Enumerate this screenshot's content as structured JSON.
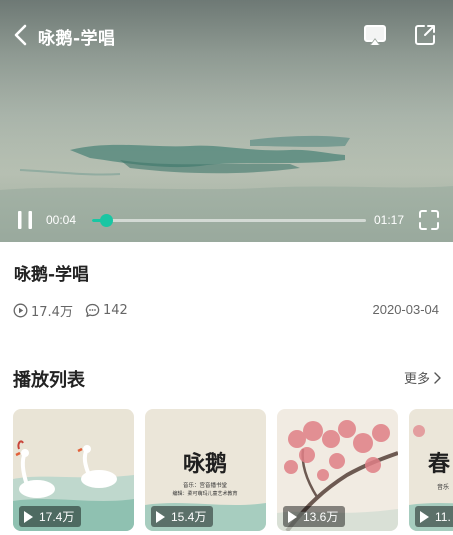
{
  "player": {
    "title": "咏鹅-学唱",
    "current_time": "00:04",
    "total_time": "01:17",
    "progress": 0.052,
    "accent": "#19c6a3",
    "icons": {
      "back": "chevron-left-icon",
      "cast": "cast-icon",
      "share": "share-icon",
      "pause": "pause-icon",
      "fullscreen": "fullscreen-icon"
    }
  },
  "info": {
    "title": "咏鹅-学唱",
    "plays": "17.4万",
    "comments": "142",
    "date": "2020-03-04"
  },
  "playlist": {
    "heading": "播放列表",
    "more": "更多",
    "items": [
      {
        "plays": "17.4万"
      },
      {
        "plays": "15.4万",
        "art_title": "咏鹅",
        "art_credit1": "音乐：宫音播书堂",
        "art_credit2": "编辑：柔可萌玛儿童艺术教育"
      },
      {
        "plays": "13.6万"
      },
      {
        "plays": "11.",
        "art_title": "春",
        "art_credit": "音乐"
      }
    ]
  }
}
